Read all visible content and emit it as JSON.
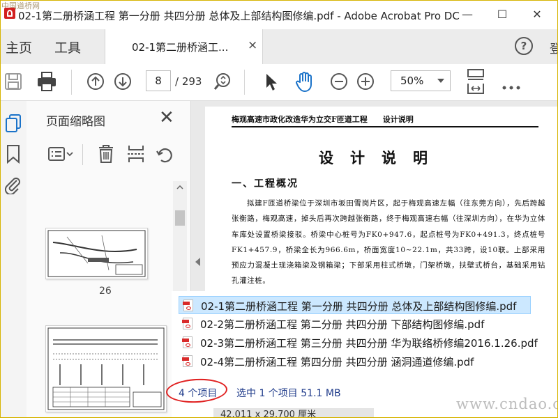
{
  "window": {
    "title": "02-1第二册桥涵工程 第一分册 共四分册 总体及上部结构图修编.pdf - Adobe Acrobat Pro DC",
    "corner_watermark": "中国道桥网",
    "minimize": "—",
    "maximize": "☐",
    "close": "✕"
  },
  "tabs": {
    "home": "主页",
    "tools": "工具",
    "document": "02-1第二册桥涵工...",
    "close": "×",
    "help": "?",
    "signin": "登"
  },
  "toolbar": {
    "current_page": "8",
    "total_pages": "/ 293",
    "zoom": "50%"
  },
  "thumbnails": {
    "title": "页面缩略图",
    "close": "✕",
    "pages": [
      {
        "label": "26"
      },
      {
        "label": ""
      }
    ]
  },
  "document": {
    "header": "梅观高速市政化改造华为立交F匝道工程　　设计说明",
    "title": "设计说明",
    "section_heading": "一、工程概况",
    "paragraph": "拟建F匝道桥梁位于深圳市坂田雪岗片区，起于梅观高速左幅（往东莞方向），先后跨越张衡路，梅观高速，掉头后再次跨越张衡路，终于梅观高速右幅（往深圳方向），在华为立体车库处设置桥梁接驳。桥梁中心桩号为FK0+947.6，起点桩号为FK0+491.3，终点桩号FK1+457.9，桥梁全长为966.6m，桥面宽度10~22.1m，共33跨，设10联。上部采用预应力混凝土现浇箱梁及钢箱梁；下部采用柱式桥墩，门架桥墩，扶壁式桥台，基础采用钻孔灌注桩。"
  },
  "explorer": {
    "files": [
      {
        "name": "02-1第二册桥涵工程 第一分册 共四分册 总体及上部结构图修编.pdf",
        "selected": true
      },
      {
        "name": "02-2第二册桥涵工程 第二分册 共四分册 下部结构图修编.pdf",
        "selected": false
      },
      {
        "name": "02-3第二册桥涵工程 第三分册 共四分册 华为联络桥修编2016.1.26.pdf",
        "selected": false
      },
      {
        "name": "02-4第二册桥涵工程 第四分册  共四分册 涵洞通道修编.pdf",
        "selected": false
      }
    ],
    "status_count": "4 个项目",
    "status_selection": "选中 1 个项目  51.1 MB",
    "page_size": "42.011 x 29.700 厘米"
  },
  "watermark": "www.cndao.com",
  "colors": {
    "selection_bg": "#cce8ff",
    "annotation_red": "#e02020",
    "pdf_red": "#d92b2b",
    "status_text": "#1e3a8a"
  }
}
